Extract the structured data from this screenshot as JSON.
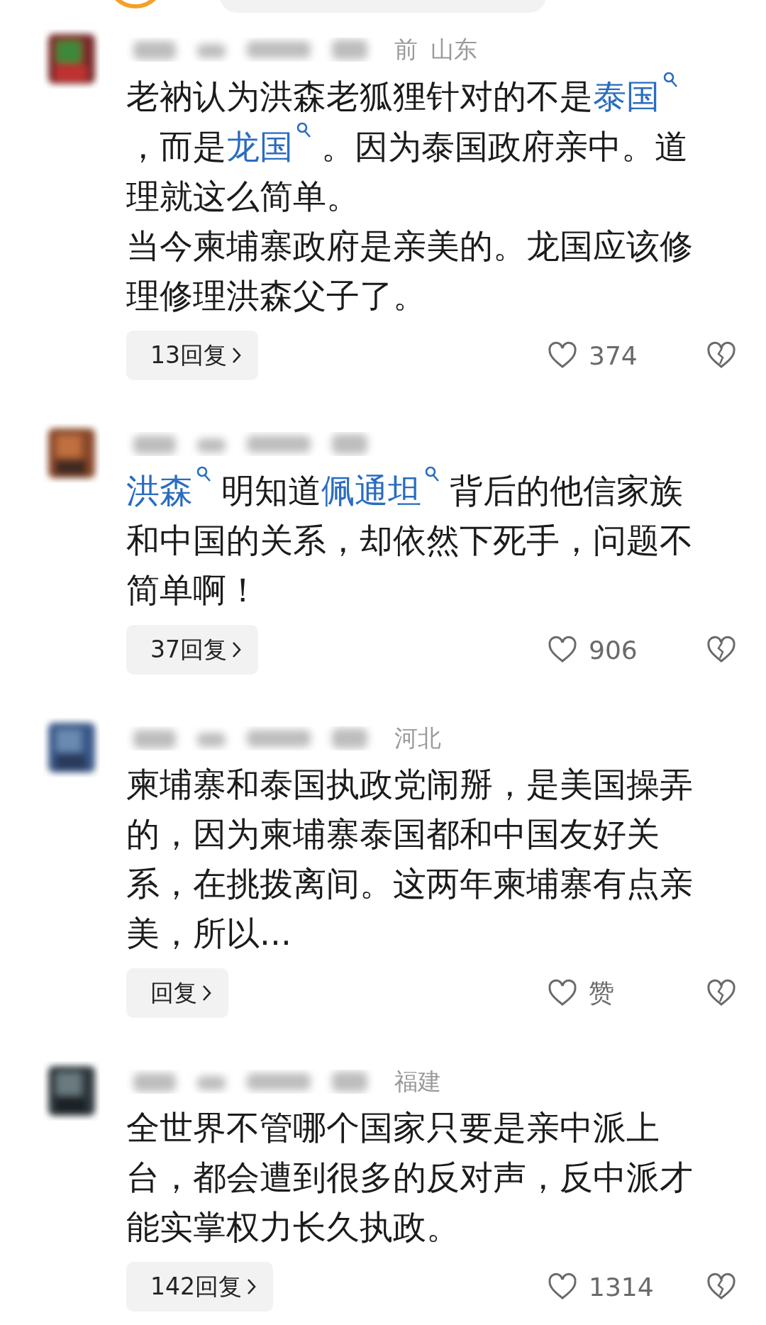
{
  "comments": [
    {
      "meta": [
        "前",
        "山东"
      ],
      "body": [
        [
          {
            "kind": "text",
            "text": "老衲认为洪森老狐狸针对的不是"
          },
          {
            "kind": "link",
            "text": "泰国"
          },
          {
            "kind": "text",
            "text": "，而是"
          },
          {
            "kind": "link",
            "text": "龙国"
          },
          {
            "kind": "text",
            "text": "。因为泰国政府亲中。道理就这么简单。"
          }
        ],
        [
          {
            "kind": "text",
            "text": "当今柬埔寨政府是亲美的。龙国应该修理修理洪森父子了。"
          }
        ]
      ],
      "replies": "13回复",
      "likes": "374"
    },
    {
      "body": [
        [
          {
            "kind": "link",
            "text": "洪森"
          },
          {
            "kind": "text",
            "text": "明知道"
          },
          {
            "kind": "link",
            "text": "佩通坦"
          },
          {
            "kind": "text",
            "text": "背后的他信家族和中国的关系，却依然下死手，问题不简单啊！"
          }
        ]
      ],
      "replies": "37回复",
      "likes": "906"
    },
    {
      "meta": [
        "河北"
      ],
      "body": [
        [
          {
            "kind": "text",
            "text": "柬埔寨和泰国执政党闹掰，是美国操弄的，因为柬埔寨泰国都和中国友好关系，在挑拨离间。这两年柬埔寨有点亲美，所以..."
          }
        ]
      ],
      "replies": "回复",
      "likes": "赞"
    },
    {
      "meta": [
        "福建"
      ],
      "body": [
        [
          {
            "kind": "text",
            "text": "全世界不管哪个国家只要是亲中派上台，都会遭到很多的反对声，反中派才能实掌权力长久执政。"
          }
        ]
      ],
      "replies": "142回复",
      "likes": "1314"
    }
  ]
}
